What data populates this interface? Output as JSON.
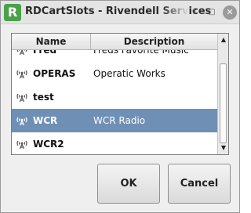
{
  "window": {
    "title": "RDCartSlots - Rivendell Services",
    "icon_letter": "R",
    "controls": {
      "up": "⬆",
      "restore": "▢",
      "close": "✕"
    }
  },
  "list": {
    "columns": {
      "name": "Name",
      "description": "Description"
    },
    "rows": [
      {
        "name": "Fred",
        "description": "Freds Favorite Music",
        "icon": "antenna-icon"
      },
      {
        "name": "OPERAS",
        "description": "Operatic Works",
        "icon": "antenna-icon"
      },
      {
        "name": "test",
        "description": "",
        "icon": "antenna-icon"
      },
      {
        "name": "WCR",
        "description": "WCR Radio",
        "icon": "antenna-icon",
        "selected": true
      },
      {
        "name": "WCR2",
        "description": "",
        "icon": "antenna-icon"
      }
    ],
    "scroll": {
      "up": "▲",
      "down": "▼"
    }
  },
  "buttons": {
    "ok": "OK",
    "cancel": "Cancel"
  },
  "colors": {
    "selection": "#6f8fb5",
    "app_icon": "#4aa14a"
  }
}
